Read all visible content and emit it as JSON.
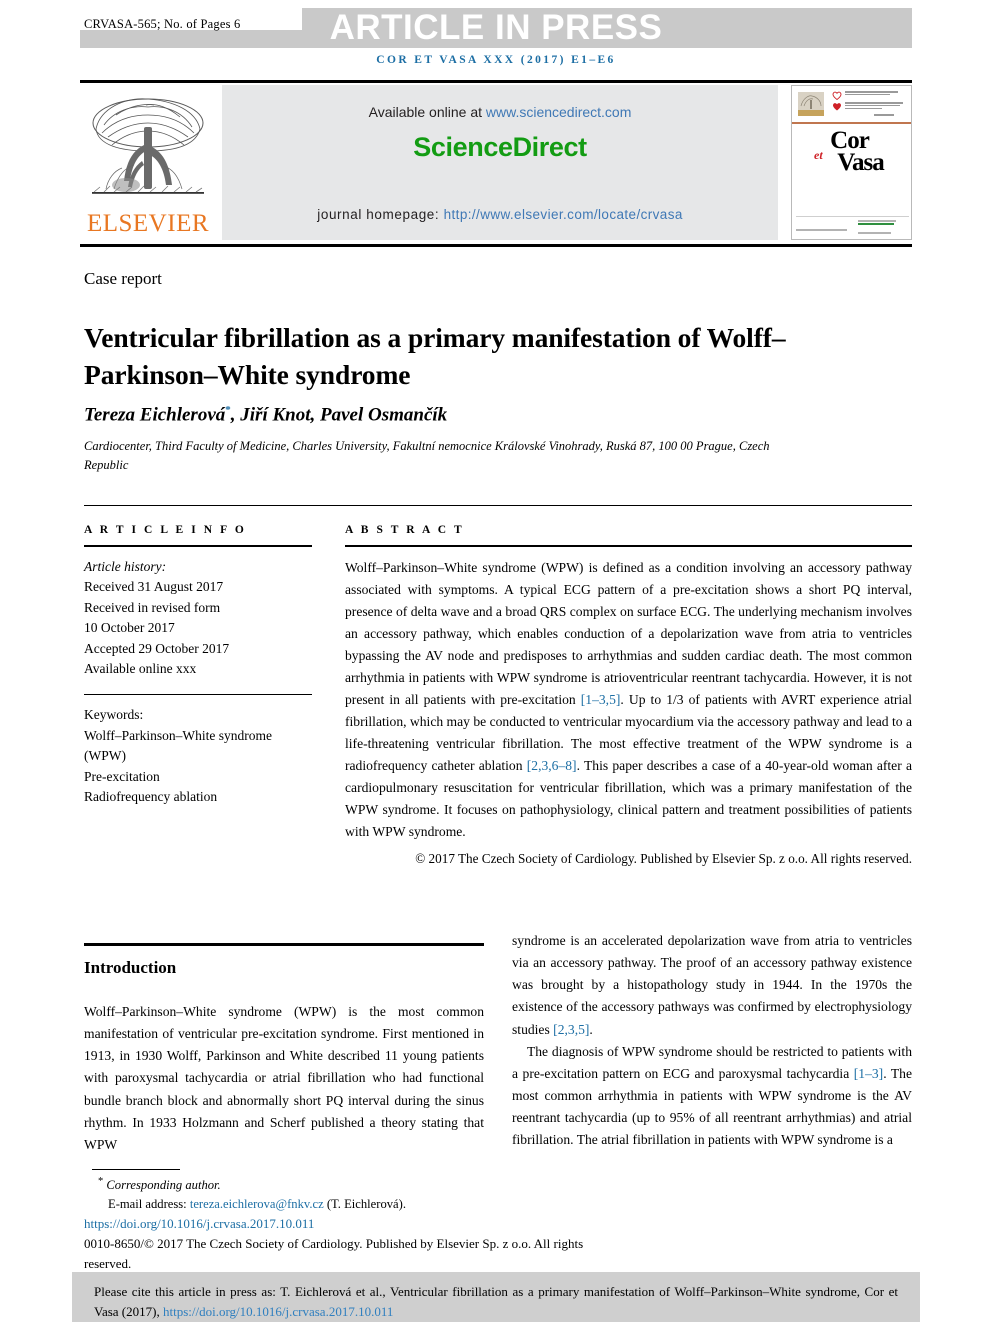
{
  "topbar": {
    "article_id": "CRVASA-565; No. of Pages 6",
    "status": "ARTICLE IN PRESS",
    "running_head": "COR ET VASA XXX (2017) E1–E6"
  },
  "masthead": {
    "available_prefix": "Available online at ",
    "available_url": "www.sciencedirect.com",
    "sciencedirect_logo": "ScienceDirect",
    "homepage_prefix": "journal homepage: ",
    "homepage_url": "http://www.elsevier.com/locate/crvasa",
    "publisher_wordmark": "ELSEVIER",
    "cover_title_1": "Cor",
    "cover_title_et": "et",
    "cover_title_2": "Vasa",
    "accent_green": "#139c13",
    "accent_link": "#3f78b5",
    "accent_orange": "#e87722",
    "accent_runhead": "#1c6ea4"
  },
  "article": {
    "section_label": "Case report",
    "title": "Ventricular fibrillation as a primary manifestation of Wolff–Parkinson–White syndrome",
    "authors": "Tereza Eichlerová",
    "authors_rest": ", Jiří Knot, Pavel Osmančík",
    "corresponding_marker": "*",
    "affiliation": "Cardiocenter, Third Faculty of Medicine, Charles University, Fakultní nemocnice Královské Vinohrady, Ruská 87, 100 00 Prague, Czech Republic"
  },
  "article_info": {
    "heading": "A R T I C L E   I N F O",
    "history_label": "Article history:",
    "history": [
      "Received 31 August 2017",
      "Received in revised form",
      "10 October 2017",
      "Accepted 29 October 2017",
      "Available online xxx"
    ],
    "keywords_label": "Keywords:",
    "keywords": [
      "Wolff–Parkinson–White syndrome",
      "(WPW)",
      "Pre-excitation",
      "Radiofrequency ablation"
    ]
  },
  "abstract": {
    "heading": "A B S T R A C T",
    "p1_a": "Wolff–Parkinson–White syndrome (WPW) is defined as a condition involving an accessory pathway associated with symptoms. A typical ECG pattern of a pre-excitation shows a short PQ interval, presence of delta wave and a broad QRS complex on surface ECG. The underlying mechanism involves an accessory pathway, which enables conduction of a depolarization wave from atria to ventricles bypassing the AV node and predisposes to arrhythmias and sudden cardiac death. The most common arrhythmia in patients with WPW syndrome is atrioventricular reentrant tachycardia. However, it is not present in all patients with pre-excitation ",
    "ref1": "[1–3,5]",
    "p1_b": ". Up to 1/3 of patients with AVRT experience atrial fibrillation, which may be conducted to ventricular myocardium via the accessory pathway and lead to a life-threatening ventricular fibrillation. The most effective treatment of the WPW syndrome is a radiofrequency catheter ablation ",
    "ref2": "[2,3,6–8]",
    "p1_c": ". This paper describes a case of a 40-year-old woman after a cardiopulmonary resuscitation for ventricular fibrillation, which was a primary manifestation of the WPW syndrome. It focuses on pathophysiology, clinical pattern and treatment possibilities of patients with WPW syndrome.",
    "copyright": "© 2017 The Czech Society of Cardiology. Published by Elsevier Sp. z o.o. All rights reserved."
  },
  "body": {
    "intro_heading": "Introduction",
    "left_p1": "Wolff–Parkinson–White syndrome (WPW) is the most common manifestation of ventricular pre-excitation syndrome. First mentioned in 1913, in 1930 Wolff, Parkinson and White described 11 young patients with paroxysmal tachycardia or atrial fibrillation who had functional bundle branch block and abnormally short PQ interval during the sinus rhythm. In 1933 Holzmann and Scherf published a theory stating that WPW",
    "right_p1_a": "syndrome is an accelerated depolarization wave from atria to ventricles via an accessory pathway. The proof of an accessory pathway existence was brought by a histopathology study in 1944. In the 1970s the existence of the accessory pathways was confirmed by electrophysiology studies ",
    "right_ref1": "[2,3,5]",
    "right_p1_b": ".",
    "right_p2_a": "The diagnosis of WPW syndrome should be restricted to patients with a pre-excitation pattern on ECG and paroxysmal tachycardia ",
    "right_ref2": "[1–3]",
    "right_p2_b": ". The most common arrhythmia in patients with WPW syndrome is the AV reentrant tachycardia (up to 95% of all reentrant arrhythmias) and atrial fibrillation. The atrial fibrillation in patients with WPW syndrome is a"
  },
  "footnotes": {
    "corresponding_marker": "*",
    "corresponding_label": "Corresponding author.",
    "email_label": "E-mail address: ",
    "email": "tereza.eichlerova@fnkv.cz",
    "email_suffix": " (T. Eichlerová).",
    "doi": "https://doi.org/10.1016/j.crvasa.2017.10.011",
    "issn_line": "0010-8650/© 2017 The Czech Society of Cardiology. Published by Elsevier Sp. z o.o. All rights reserved."
  },
  "citation_box": {
    "text_a": "Please cite this article in press as: T. Eichlerová et al., Ventricular fibrillation as a primary manifestation of Wolff–Parkinson–White syndrome, Cor et Vasa (2017), ",
    "link": "https://doi.org/10.1016/j.crvasa.2017.10.011"
  }
}
